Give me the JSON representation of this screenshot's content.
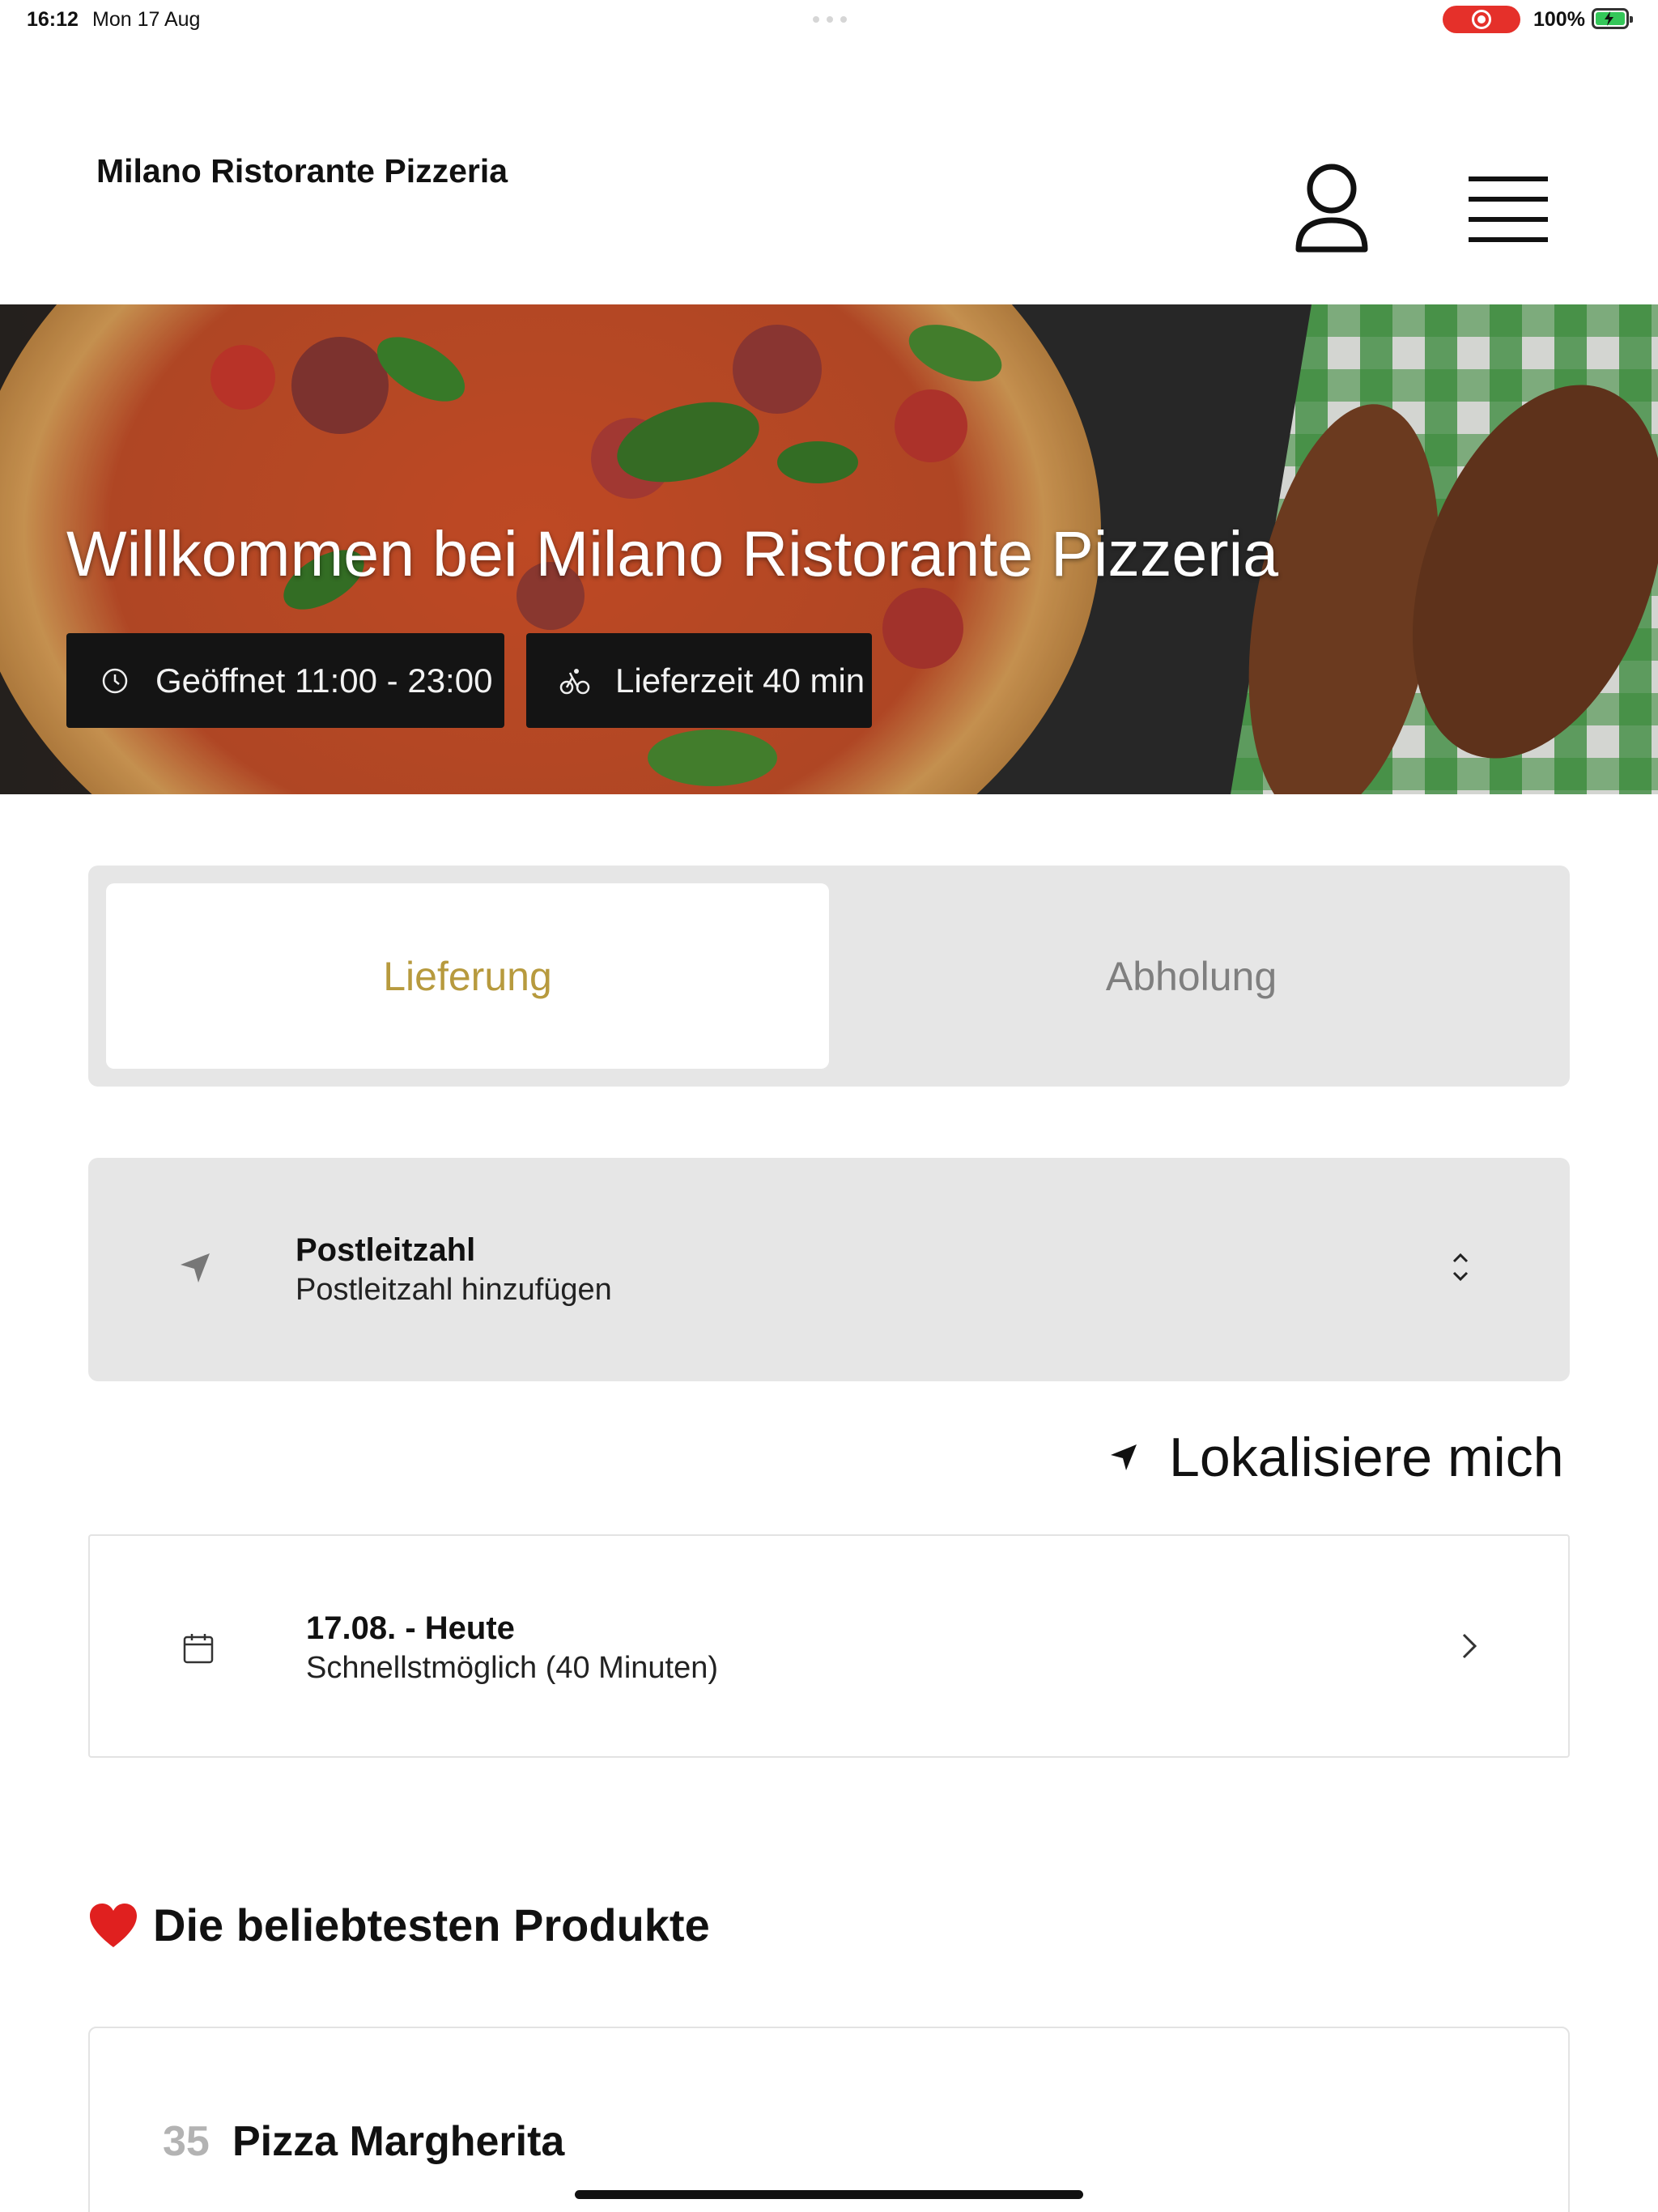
{
  "status_bar": {
    "time": "16:12",
    "date": "Mon 17 Aug",
    "battery": "100%",
    "recording_color": "#e5302a",
    "battery_color": "#34c759"
  },
  "header": {
    "title": "Milano Ristorante Pizzeria",
    "account_icon": "person-outline-icon",
    "menu_icon": "hamburger-menu-icon"
  },
  "hero": {
    "title": "Willkommen bei Milano Ristorante Pizzeria",
    "opening_hours": "Geöffnet 11:00 - 23:00",
    "delivery_time": "Lieferzeit 40 min",
    "opening_icon": "clock-icon",
    "delivery_icon": "bicycle-icon"
  },
  "mode_toggle": {
    "delivery": "Lieferung",
    "pickup": "Abholung",
    "selected": "Lieferung",
    "accent_color": "#b79a3e"
  },
  "postal_code": {
    "label": "Postleitzahl",
    "value": "Postleitzahl hinzufügen",
    "icon": "navigation-arrow-icon"
  },
  "locate_me": {
    "label": "Lokalisiere mich",
    "icon": "location-arrow-icon"
  },
  "delivery_time_selector": {
    "title": "17.08. - Heute",
    "subtitle": "Schnellstmöglich (40 Minuten)",
    "icon": "calendar-icon"
  },
  "popular": {
    "title": "Die beliebtesten Produkte",
    "icon": "heart-icon",
    "products": [
      {
        "number": "35",
        "name": "Pizza Margherita"
      }
    ]
  }
}
